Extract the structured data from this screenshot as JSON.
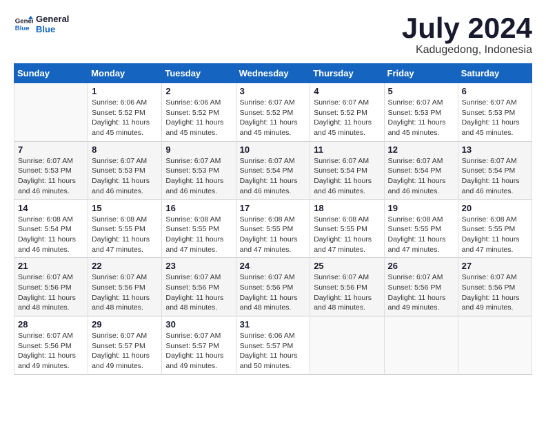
{
  "logo": {
    "line1": "General",
    "line2": "Blue"
  },
  "title": "July 2024",
  "subtitle": "Kadugedong, Indonesia",
  "days_header": [
    "Sunday",
    "Monday",
    "Tuesday",
    "Wednesday",
    "Thursday",
    "Friday",
    "Saturday"
  ],
  "weeks": [
    [
      {
        "day": "",
        "info": ""
      },
      {
        "day": "1",
        "info": "Sunrise: 6:06 AM\nSunset: 5:52 PM\nDaylight: 11 hours and 45 minutes."
      },
      {
        "day": "2",
        "info": "Sunrise: 6:06 AM\nSunset: 5:52 PM\nDaylight: 11 hours and 45 minutes."
      },
      {
        "day": "3",
        "info": "Sunrise: 6:07 AM\nSunset: 5:52 PM\nDaylight: 11 hours and 45 minutes."
      },
      {
        "day": "4",
        "info": "Sunrise: 6:07 AM\nSunset: 5:52 PM\nDaylight: 11 hours and 45 minutes."
      },
      {
        "day": "5",
        "info": "Sunrise: 6:07 AM\nSunset: 5:53 PM\nDaylight: 11 hours and 45 minutes."
      },
      {
        "day": "6",
        "info": "Sunrise: 6:07 AM\nSunset: 5:53 PM\nDaylight: 11 hours and 45 minutes."
      }
    ],
    [
      {
        "day": "7",
        "info": "Sunrise: 6:07 AM\nSunset: 5:53 PM\nDaylight: 11 hours and 46 minutes."
      },
      {
        "day": "8",
        "info": "Sunrise: 6:07 AM\nSunset: 5:53 PM\nDaylight: 11 hours and 46 minutes."
      },
      {
        "day": "9",
        "info": "Sunrise: 6:07 AM\nSunset: 5:53 PM\nDaylight: 11 hours and 46 minutes."
      },
      {
        "day": "10",
        "info": "Sunrise: 6:07 AM\nSunset: 5:54 PM\nDaylight: 11 hours and 46 minutes."
      },
      {
        "day": "11",
        "info": "Sunrise: 6:07 AM\nSunset: 5:54 PM\nDaylight: 11 hours and 46 minutes."
      },
      {
        "day": "12",
        "info": "Sunrise: 6:07 AM\nSunset: 5:54 PM\nDaylight: 11 hours and 46 minutes."
      },
      {
        "day": "13",
        "info": "Sunrise: 6:07 AM\nSunset: 5:54 PM\nDaylight: 11 hours and 46 minutes."
      }
    ],
    [
      {
        "day": "14",
        "info": "Sunrise: 6:08 AM\nSunset: 5:54 PM\nDaylight: 11 hours and 46 minutes."
      },
      {
        "day": "15",
        "info": "Sunrise: 6:08 AM\nSunset: 5:55 PM\nDaylight: 11 hours and 47 minutes."
      },
      {
        "day": "16",
        "info": "Sunrise: 6:08 AM\nSunset: 5:55 PM\nDaylight: 11 hours and 47 minutes."
      },
      {
        "day": "17",
        "info": "Sunrise: 6:08 AM\nSunset: 5:55 PM\nDaylight: 11 hours and 47 minutes."
      },
      {
        "day": "18",
        "info": "Sunrise: 6:08 AM\nSunset: 5:55 PM\nDaylight: 11 hours and 47 minutes."
      },
      {
        "day": "19",
        "info": "Sunrise: 6:08 AM\nSunset: 5:55 PM\nDaylight: 11 hours and 47 minutes."
      },
      {
        "day": "20",
        "info": "Sunrise: 6:08 AM\nSunset: 5:55 PM\nDaylight: 11 hours and 47 minutes."
      }
    ],
    [
      {
        "day": "21",
        "info": "Sunrise: 6:07 AM\nSunset: 5:56 PM\nDaylight: 11 hours and 48 minutes."
      },
      {
        "day": "22",
        "info": "Sunrise: 6:07 AM\nSunset: 5:56 PM\nDaylight: 11 hours and 48 minutes."
      },
      {
        "day": "23",
        "info": "Sunrise: 6:07 AM\nSunset: 5:56 PM\nDaylight: 11 hours and 48 minutes."
      },
      {
        "day": "24",
        "info": "Sunrise: 6:07 AM\nSunset: 5:56 PM\nDaylight: 11 hours and 48 minutes."
      },
      {
        "day": "25",
        "info": "Sunrise: 6:07 AM\nSunset: 5:56 PM\nDaylight: 11 hours and 48 minutes."
      },
      {
        "day": "26",
        "info": "Sunrise: 6:07 AM\nSunset: 5:56 PM\nDaylight: 11 hours and 49 minutes."
      },
      {
        "day": "27",
        "info": "Sunrise: 6:07 AM\nSunset: 5:56 PM\nDaylight: 11 hours and 49 minutes."
      }
    ],
    [
      {
        "day": "28",
        "info": "Sunrise: 6:07 AM\nSunset: 5:56 PM\nDaylight: 11 hours and 49 minutes."
      },
      {
        "day": "29",
        "info": "Sunrise: 6:07 AM\nSunset: 5:57 PM\nDaylight: 11 hours and 49 minutes."
      },
      {
        "day": "30",
        "info": "Sunrise: 6:07 AM\nSunset: 5:57 PM\nDaylight: 11 hours and 49 minutes."
      },
      {
        "day": "31",
        "info": "Sunrise: 6:06 AM\nSunset: 5:57 PM\nDaylight: 11 hours and 50 minutes."
      },
      {
        "day": "",
        "info": ""
      },
      {
        "day": "",
        "info": ""
      },
      {
        "day": "",
        "info": ""
      }
    ]
  ]
}
